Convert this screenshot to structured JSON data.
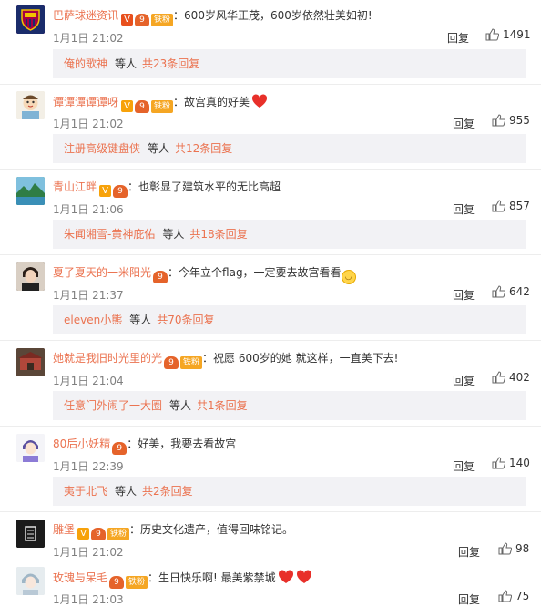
{
  "common": {
    "reply_label": "回复",
    "reply_more_middle": "等人",
    "badge_label": "铁粉"
  },
  "colors": {
    "username": "#eb7350",
    "time": "#808080",
    "reply_box_bg": "#f2f2f5",
    "heart": "#e8302a"
  },
  "comments": [
    {
      "user": "巴萨球迷资讯",
      "text": "600岁风华正茂，600岁依然壮美如初!",
      "time": "1月1日 21:02",
      "likes": "1491",
      "replies": {
        "first_user": "俺的歌神",
        "count_text": "共23条回复"
      }
    },
    {
      "user": "谭谭谭谭谭呀",
      "text": "故宫真的好美",
      "time": "1月1日 21:02",
      "likes": "955",
      "replies": {
        "first_user": "注册高级键盘侠",
        "count_text": "共12条回复"
      }
    },
    {
      "user": "青山江畔",
      "text": "也彰显了建筑水平的无比高超",
      "time": "1月1日 21:06",
      "likes": "857",
      "replies": {
        "first_user": "朱闻湘雪-黄神庇佑",
        "count_text": "共18条回复"
      }
    },
    {
      "user": "夏了夏天的一米阳光",
      "text": "今年立个flag，一定要去故宫看看",
      "time": "1月1日 21:37",
      "likes": "642",
      "replies": {
        "first_user": "eleven小熊",
        "count_text": "共70条回复"
      }
    },
    {
      "user": "她就是我旧时光里的光",
      "text": "祝愿  600岁的她  就这样，一直美下去!",
      "time": "1月1日 21:04",
      "likes": "402",
      "replies": {
        "first_user": "任意门外闹了一大圈",
        "count_text": "共1条回复"
      }
    },
    {
      "user": "80后小妖精",
      "text": "好美，我要去看故宫",
      "time": "1月1日 22:39",
      "likes": "140",
      "replies": {
        "first_user": "夷于北飞",
        "count_text": "共2条回复"
      }
    },
    {
      "user": "雕堡",
      "text": "历史文化遗产，值得回味铭记。",
      "time": "1月1日 21:02",
      "likes": "98"
    },
    {
      "user": "玫瑰与呆毛",
      "text": "生日快乐啊! 最美紫禁城",
      "time": "1月1日 21:03",
      "likes": "75"
    }
  ]
}
